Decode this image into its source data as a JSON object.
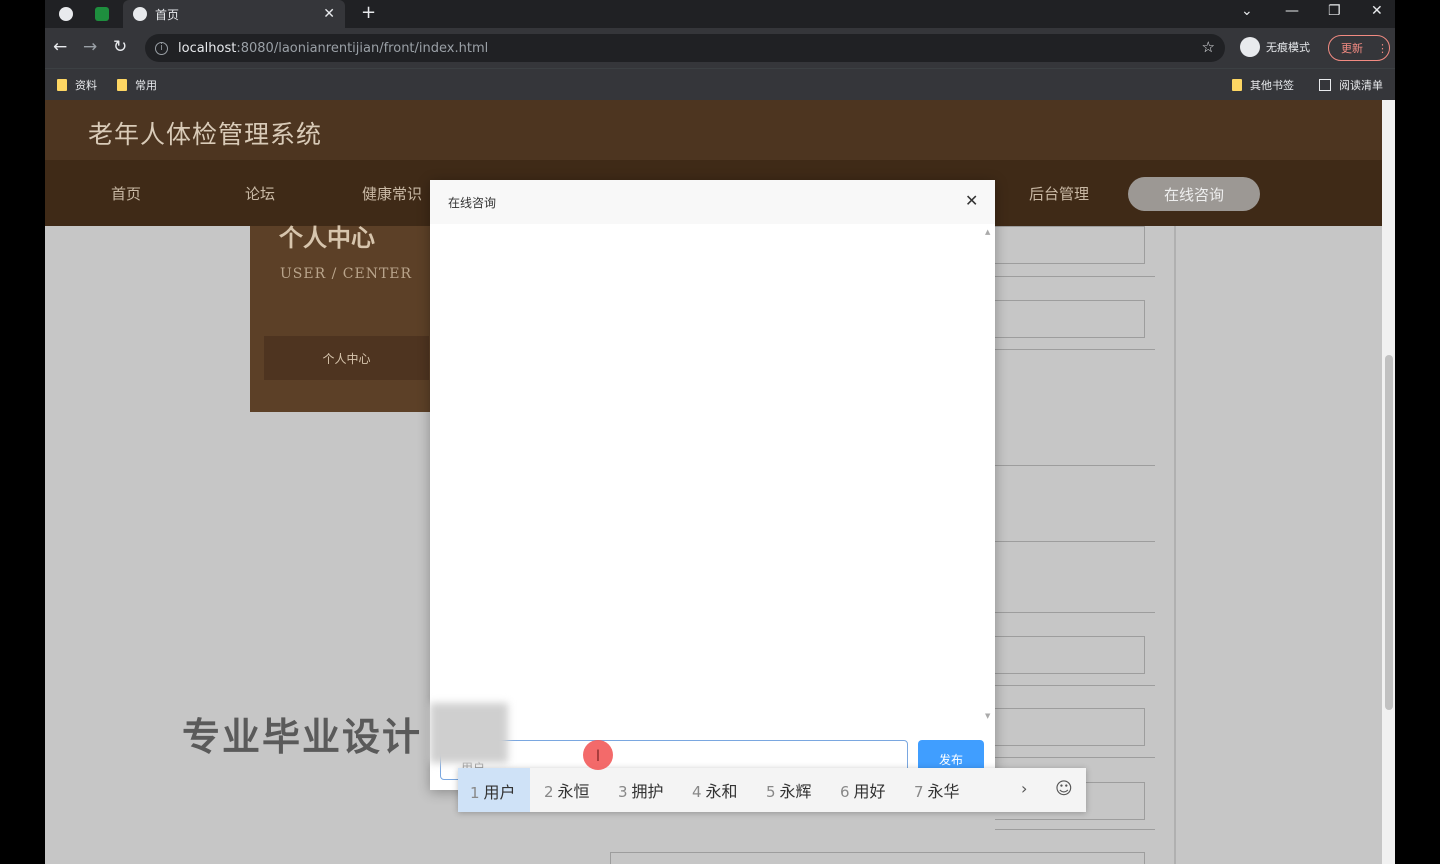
{
  "browser": {
    "tab_active_title": "首页",
    "url_host": "localhost",
    "url_rest": ":8080/laonianrentijian/front/index.html",
    "incognito_label": "无痕模式",
    "update_label": "更新",
    "bookmarks": [
      "资料",
      "常用"
    ],
    "bookmarks_right": [
      "其他书签",
      "阅读清单"
    ]
  },
  "site": {
    "title": "老年人体检管理系统",
    "nav": [
      "首页",
      "论坛",
      "健康常识",
      "后台管理"
    ],
    "nav_active": "在线咨询"
  },
  "user_card": {
    "title": "个人中心",
    "subtitle": "USER / CENTER",
    "button": "个人中心"
  },
  "banner": {
    "text": "专业毕业设计"
  },
  "modal": {
    "title": "在线咨询",
    "input_value": "用户",
    "send_label": "发布"
  },
  "ime": {
    "candidates": [
      {
        "num": "1",
        "text": "用户"
      },
      {
        "num": "2",
        "text": "永恒"
      },
      {
        "num": "3",
        "text": "拥护"
      },
      {
        "num": "4",
        "text": "永和"
      },
      {
        "num": "5",
        "text": "永辉"
      },
      {
        "num": "6",
        "text": "用好"
      },
      {
        "num": "7",
        "text": "永华"
      }
    ]
  }
}
